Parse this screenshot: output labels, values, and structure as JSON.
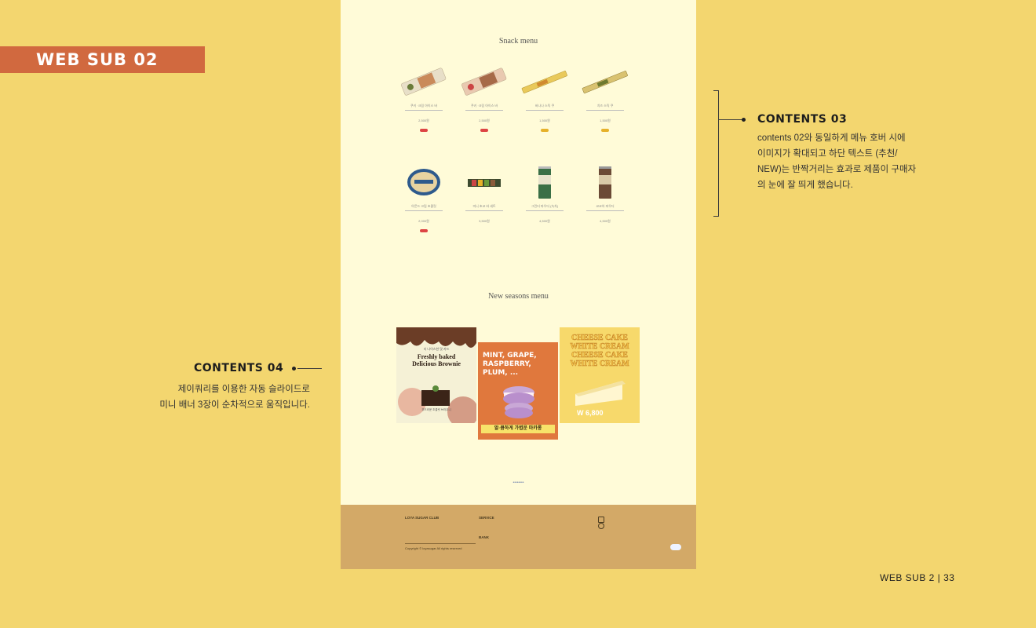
{
  "tag": "WEB SUB 02",
  "page": {
    "snack_title": "Snack menu",
    "season_title": "New seasons menu",
    "products": [
      {
        "name": "쿠키 ·크림 아이스 바",
        "price": "2,500원",
        "tag": "red"
      },
      {
        "name": "쿠키 ·크림 아이스 바",
        "price": "2,500원",
        "tag": "red"
      },
      {
        "name": "바나나 스틱 쿠",
        "price": "1,500원",
        "tag": "yellow"
      },
      {
        "name": "치즈 스틱 쿠",
        "price": "1,500원",
        "tag": "yellow"
      },
      {
        "name": "아몬드 크림 초콜릿",
        "price": "2,000원",
        "tag": "red"
      },
      {
        "name": "미니 초코 바 세트",
        "price": "3,500원",
        "tag": ""
      },
      {
        "name": "그린티 파우더 (녹차)",
        "price": "4,500원",
        "tag": ""
      },
      {
        "name": "코코아 파우더",
        "price": "4,500원",
        "tag": ""
      }
    ],
    "banner1": {
      "small": "더 나이스한 맛 카드",
      "title": "Freshly baked Delicious Brownie",
      "sub": "부드러운 초콜릿 브라우니"
    },
    "banner2": {
      "title": "MINT, GRAPE, RASPBERRY, PLUM, ...",
      "bottom": "알·콤하게 가볍운 마카롱"
    },
    "banner3": {
      "line1": "CHEESE CAKE",
      "line2": "WHITE CREAM",
      "line3": "CHEESE CAKE",
      "line4": "WHITE CREAM",
      "price": "W 6,800"
    },
    "dots": "••••••••",
    "footer": {
      "brand": "LOYA SUGAR CLUB",
      "service": "SERVICE",
      "bank": "BANK",
      "copyright": "Copyright © loyasugar All rights reserved"
    }
  },
  "contents03": {
    "heading": "CONTENTS 03",
    "lines": [
      "contents 02와 동일하게 메뉴 호버 시에",
      "이미지가 확대되고 하단 텍스트 (추천/",
      "NEW)는 반짝거리는 효과로 제품이 구매자",
      "의 눈에 잘 띄게 했습니다."
    ]
  },
  "contents04": {
    "heading": "CONTENTS 04",
    "lines": [
      "제이쿼리를 이용한 자동 슬라이드로",
      "미니 배너 3장이 순차적으로 움직입니다."
    ]
  },
  "page_footer": "WEB SUB 2  |   33"
}
